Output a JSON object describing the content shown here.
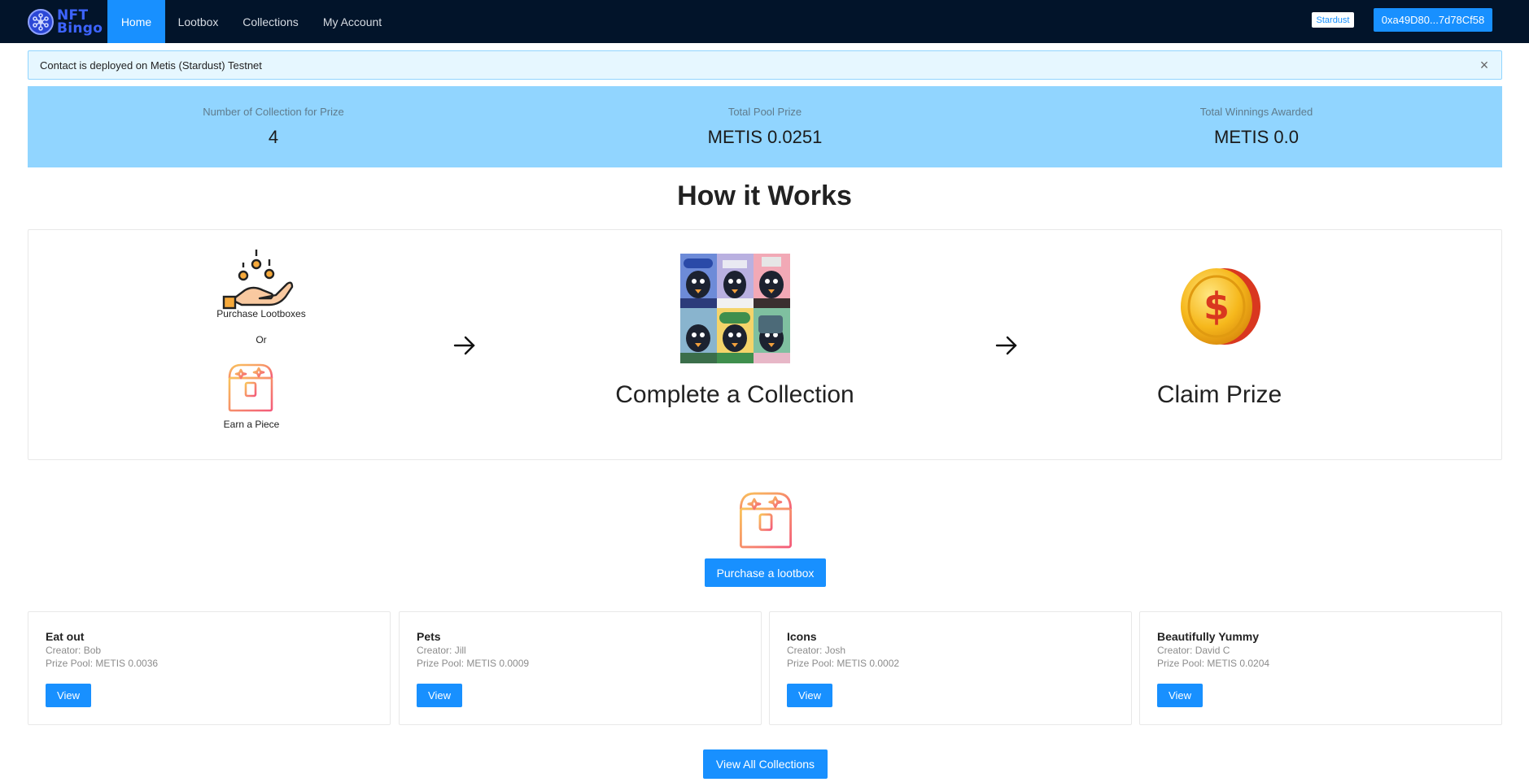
{
  "nav": {
    "logo_line1": "NFT",
    "logo_line2": "Bingo",
    "items": [
      {
        "label": "Home",
        "active": true
      },
      {
        "label": "Lootbox",
        "active": false
      },
      {
        "label": "Collections",
        "active": false
      },
      {
        "label": "My Account",
        "active": false
      }
    ],
    "network_label": "Stardust",
    "wallet_address": "0xa49D80...7d78Cf58"
  },
  "alert": {
    "message": "Contact is deployed on Metis (Stardust) Testnet",
    "close_glyph": "×"
  },
  "stats": [
    {
      "label": "Number of Collection for Prize",
      "value": "4"
    },
    {
      "label": "Total Pool Prize",
      "value": "METIS 0.0251"
    },
    {
      "label": "Total Winnings Awarded",
      "value": "METIS 0.0"
    }
  ],
  "how_it_works": {
    "title": "How it Works",
    "step1_top_caption": "Purchase Lootboxes",
    "step1_or": "Or",
    "step1_bottom_caption": "Earn a Piece",
    "step2_caption": "Complete a Collection",
    "step3_caption": "Claim Prize",
    "icons": [
      "hand-coins-icon",
      "treasure-chest-icon",
      "nft-collage-image",
      "gold-dollar-coin-icon",
      "arrow-right-icon"
    ]
  },
  "purchase": {
    "button_label": "Purchase a lootbox"
  },
  "collections": {
    "creator_prefix": "Creator: ",
    "prize_prefix": "Prize Pool: ",
    "view_label": "View",
    "items": [
      {
        "title": "Eat out",
        "creator": "Bob",
        "prize_pool": "METIS 0.0036"
      },
      {
        "title": "Pets",
        "creator": "Jill",
        "prize_pool": "METIS 0.0009"
      },
      {
        "title": "Icons",
        "creator": "Josh",
        "prize_pool": "METIS 0.0002"
      },
      {
        "title": "Beautifully Yummy",
        "creator": "David C",
        "prize_pool": "METIS 0.0204"
      }
    ],
    "view_all_label": "View All Collections"
  },
  "colors": {
    "navbar_bg": "#02142a",
    "accent": "#1890ff",
    "stats_bg": "#91d5ff",
    "alert_bg": "#e6f7ff"
  }
}
